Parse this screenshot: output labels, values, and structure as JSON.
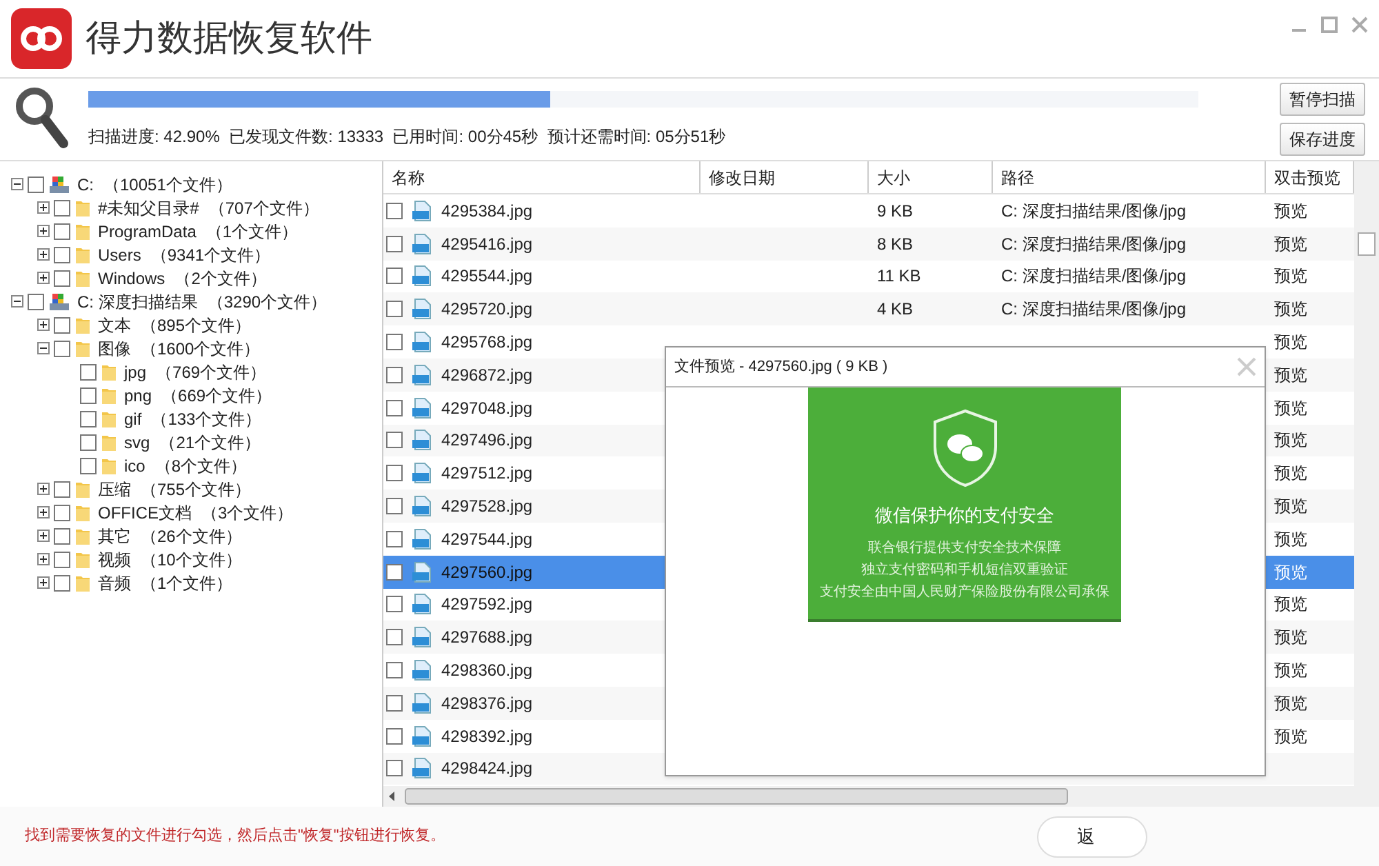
{
  "window": {
    "title": "得力数据恢复软件"
  },
  "scan": {
    "level": 0.416,
    "stats": "扫描进度: 42.90%  已发现文件数: 13333  已用时间: 00分45秒  预计还需时间: 05分51秒",
    "buttons": [
      "暂停扫描",
      "保存进度"
    ]
  },
  "tree": [
    {
      "label": "C:",
      "count": "（10051个文件）",
      "kind": "drive",
      "expanded": true,
      "checked": false,
      "children": [
        {
          "label": "#未知父目录#",
          "count": "（707个文件）",
          "kind": "folder",
          "expanded": false,
          "checked": false
        },
        {
          "label": "ProgramData",
          "count": "（1个文件）",
          "kind": "folder",
          "expanded": false,
          "checked": false
        },
        {
          "label": "Users",
          "count": "（9341个文件）",
          "kind": "folder",
          "expanded": false,
          "checked": false
        },
        {
          "label": "Windows",
          "count": "（2个文件）",
          "kind": "folder",
          "expanded": false,
          "checked": false
        }
      ]
    },
    {
      "label": "C: 深度扫描结果",
      "count": "（3290个文件）",
      "kind": "drive",
      "expanded": true,
      "checked": false,
      "children": [
        {
          "label": "文本",
          "count": "（895个文件）",
          "kind": "folder",
          "expanded": false,
          "checked": false
        },
        {
          "label": "图像",
          "count": "（1600个文件）",
          "kind": "folder",
          "expanded": true,
          "checked": false,
          "children": [
            {
              "label": "jpg",
              "count": "（769个文件）",
              "kind": "folder",
              "checked": false
            },
            {
              "label": "png",
              "count": "（669个文件）",
              "kind": "folder",
              "checked": false
            },
            {
              "label": "gif",
              "count": "（133个文件）",
              "kind": "folder",
              "checked": false
            },
            {
              "label": "svg",
              "count": "（21个文件）",
              "kind": "folder",
              "checked": false
            },
            {
              "label": "ico",
              "count": "（8个文件）",
              "kind": "folder",
              "checked": false
            }
          ]
        },
        {
          "label": "压缩",
          "count": "（755个文件）",
          "kind": "folder",
          "expanded": false,
          "checked": false
        },
        {
          "label": "OFFICE文档",
          "count": "（3个文件）",
          "kind": "folder",
          "expanded": false,
          "checked": false
        },
        {
          "label": "其它",
          "count": "（26个文件）",
          "kind": "folder",
          "expanded": false,
          "checked": false
        },
        {
          "label": "视频",
          "count": "（10个文件）",
          "kind": "folder",
          "expanded": false,
          "checked": false
        },
        {
          "label": "音频",
          "count": "（1个文件）",
          "kind": "folder",
          "expanded": false,
          "checked": false
        }
      ]
    }
  ],
  "table": {
    "columns": [
      "名称",
      "修改日期",
      "大小",
      "路径",
      "双击预览"
    ],
    "rows": [
      {
        "name": "4295384.jpg",
        "size": "9 KB",
        "path": "C: 深度扫描结果/图像/jpg",
        "preview": "预览",
        "checked": false,
        "selected": false
      },
      {
        "name": "4295416.jpg",
        "size": "8 KB",
        "path": "C: 深度扫描结果/图像/jpg",
        "preview": "预览",
        "checked": false,
        "selected": false
      },
      {
        "name": "4295544.jpg",
        "size": "11 KB",
        "path": "C: 深度扫描结果/图像/jpg",
        "preview": "预览",
        "checked": false,
        "selected": false
      },
      {
        "name": "4295720.jpg",
        "size": "4 KB",
        "path": "C: 深度扫描结果/图像/jpg",
        "preview": "预览",
        "checked": false,
        "selected": false
      },
      {
        "name": "4295768.jpg",
        "preview": "预览",
        "checked": false,
        "selected": false
      },
      {
        "name": "4296872.jpg",
        "preview": "预览",
        "checked": false,
        "selected": false
      },
      {
        "name": "4297048.jpg",
        "preview": "预览",
        "checked": false,
        "selected": false
      },
      {
        "name": "4297496.jpg",
        "preview": "预览",
        "checked": false,
        "selected": false
      },
      {
        "name": "4297512.jpg",
        "preview": "预览",
        "checked": false,
        "selected": false
      },
      {
        "name": "4297528.jpg",
        "preview": "预览",
        "checked": false,
        "selected": false
      },
      {
        "name": "4297544.jpg",
        "preview": "预览",
        "checked": false,
        "selected": false
      },
      {
        "name": "4297560.jpg",
        "preview": "预览",
        "checked": false,
        "selected": true
      },
      {
        "name": "4297592.jpg",
        "preview": "预览",
        "checked": false,
        "selected": false
      },
      {
        "name": "4297688.jpg",
        "preview": "预览",
        "checked": false,
        "selected": false
      },
      {
        "name": "4298360.jpg",
        "preview": "预览",
        "checked": false,
        "selected": false
      },
      {
        "name": "4298376.jpg",
        "preview": "预览",
        "checked": false,
        "selected": false
      },
      {
        "name": "4298392.jpg",
        "preview": "预览",
        "checked": false,
        "selected": false
      },
      {
        "name": "4298424.jpg",
        "checked": false,
        "selected": false
      }
    ]
  },
  "preview_dialog": {
    "title": "文件预览 - 4297560.jpg ( 9 KB )",
    "image": {
      "headline": "微信保护你的支付安全",
      "lines": [
        "联合银行提供支付安全技术保障",
        "独立支付密码和手机短信双重验证",
        "支付安全由中国人民财产保险股份有限公司承保"
      ]
    }
  },
  "footer": {
    "hint": "找到需要恢复的文件进行勾选，然后点击\"恢复\"按钮进行恢复。",
    "button": "返"
  }
}
